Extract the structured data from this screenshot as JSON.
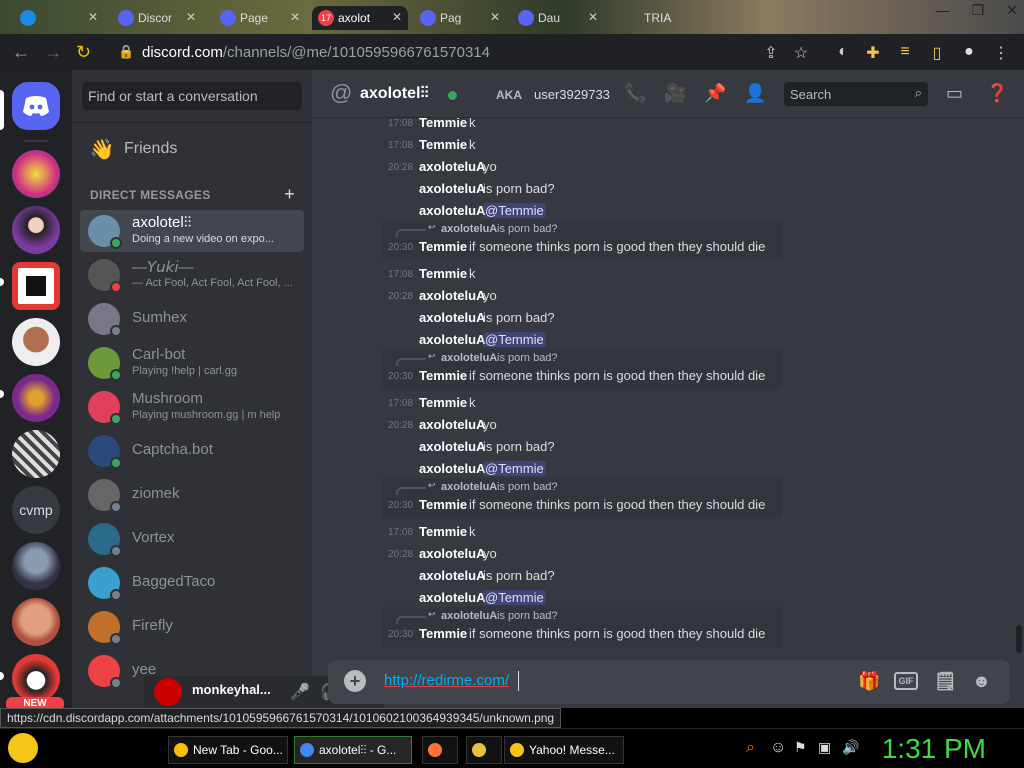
{
  "browser": {
    "tabs": [
      {
        "label": ""
      },
      {
        "label": "Discor"
      },
      {
        "label": "Page"
      },
      {
        "label": "axolot",
        "badge": "17"
      },
      {
        "label": "Pag"
      },
      {
        "label": "Dau"
      },
      {
        "label": "TRIA"
      }
    ],
    "url_host": "discord.com",
    "url_path": "/channels/@me/1010595966761570314"
  },
  "discord": {
    "search_placeholder": "Find or start a conversation",
    "friends_label": "Friends",
    "dm_header": "DIRECT MESSAGES",
    "dm_add": "+",
    "dms": [
      {
        "name": "axolotel⫶⫶",
        "sub": "Doing a new video on expo...",
        "status": "online",
        "selected": true,
        "color": "#6b8fa8"
      },
      {
        "name": "—𝘠𝘶𝘬𝘪—",
        "sub": "— Act Fool, Act Fool, Act Fool, ...",
        "status": "dnd",
        "color": "#555"
      },
      {
        "name": "Sumhex",
        "sub": "",
        "status": "offline",
        "color": "#778"
      },
      {
        "name": "Carl-bot",
        "sub": "Playing !help | carl.gg",
        "status": "online",
        "color": "#6c9a3a"
      },
      {
        "name": "Mushroom",
        "sub": "Playing mushroom.gg | m help",
        "status": "online",
        "color": "#e0405a"
      },
      {
        "name": "Captcha.bot",
        "sub": "",
        "status": "online",
        "color": "#2b4a7a"
      },
      {
        "name": "ziomek",
        "sub": "",
        "status": "offline",
        "color": "#666"
      },
      {
        "name": "Vortex",
        "sub": "",
        "status": "offline",
        "color": "#2a6a8a"
      },
      {
        "name": "BaggedTaco",
        "sub": "",
        "status": "offline",
        "color": "#3aa0d0"
      },
      {
        "name": "Firefly",
        "sub": "",
        "status": "offline",
        "color": "#c0702a"
      },
      {
        "name": "yee",
        "sub": "",
        "status": "offline",
        "color": "#ed4245"
      }
    ],
    "current_user": "monkeyhal...",
    "new_badge": "NEW",
    "guild_labels": {
      "cvmp": "cvmp"
    },
    "header": {
      "name": "axolotel⫶⫶",
      "aka_label": "AKA",
      "aka_value": "user3929733",
      "search_placeholder": "Search"
    },
    "messages": [
      {
        "time": "17:08",
        "author": "Temmie",
        "text": "k"
      },
      {
        "time": "20:28",
        "author": "axoloteluA",
        "text": "yo"
      },
      {
        "time": "",
        "author": "axoloteluA",
        "text": "is porn bad?"
      },
      {
        "time": "",
        "author": "axoloteluA",
        "text": "@Temmie",
        "mention": true
      },
      {
        "reply_author": "axoloteluA",
        "reply_text": "is porn bad?",
        "time": "20:30",
        "author": "Temmie",
        "text": "if someone thinks porn is good then they should die"
      },
      {
        "time": "17:08",
        "author": "Temmie",
        "text": "k"
      },
      {
        "time": "20:28",
        "author": "axoloteluA",
        "text": "yo"
      },
      {
        "time": "",
        "author": "axoloteluA",
        "text": "is porn bad?"
      },
      {
        "time": "",
        "author": "axoloteluA",
        "text": "@Temmie",
        "mention": true
      },
      {
        "reply_author": "axoloteluA",
        "reply_text": "is porn bad?",
        "time": "20:30",
        "author": "Temmie",
        "text": "if someone thinks porn is good then they should die"
      },
      {
        "time": "17:08",
        "author": "Temmie",
        "text": "k"
      },
      {
        "time": "20:28",
        "author": "axoloteluA",
        "text": "yo"
      },
      {
        "time": "",
        "author": "axoloteluA",
        "text": "is porn bad?"
      },
      {
        "time": "",
        "author": "axoloteluA",
        "text": "@Temmie",
        "mention": true
      },
      {
        "reply_author": "axoloteluA",
        "reply_text": "is porn bad?",
        "time": "20:30",
        "author": "Temmie",
        "text": "if someone thinks porn is good then they should die"
      },
      {
        "time": "17:08",
        "author": "Temmie",
        "text": "k"
      },
      {
        "time": "20:28",
        "author": "axoloteluA",
        "text": "yo"
      },
      {
        "time": "",
        "author": "axoloteluA",
        "text": "is porn bad?"
      },
      {
        "time": "",
        "author": "axoloteluA",
        "text": "@Temmie",
        "mention": true
      },
      {
        "reply_author": "axoloteluA",
        "reply_text": "is porn bad?",
        "time": "20:30",
        "author": "Temmie",
        "text": "if someone thinks porn is good then they should die"
      }
    ],
    "top_partial": {
      "time": "17:08",
      "author": "Temmie",
      "text": "k"
    },
    "composer_value": "http://redirme.com/"
  },
  "status_url": "https://cdn.discordapp.com/attachments/1010595966761570314/1010602100364939345/unknown.png",
  "taskbar": {
    "tasks": [
      {
        "label": "New Tab - Goo...",
        "color": "#fbbc05"
      },
      {
        "label": "axolotel⫶⫶ - G...",
        "color": "#4285f4",
        "active": true
      },
      {
        "label": "",
        "color": "#ff7139"
      },
      {
        "label": "",
        "color": "#e8c040"
      },
      {
        "label": "Yahoo! Messe...",
        "color": "#f5c518"
      }
    ],
    "clock": "1:31 PM"
  },
  "colors": {
    "blurple": "#5865f2",
    "online": "#3ba55d",
    "dnd": "#ed4245",
    "offline": "#747f8d"
  }
}
